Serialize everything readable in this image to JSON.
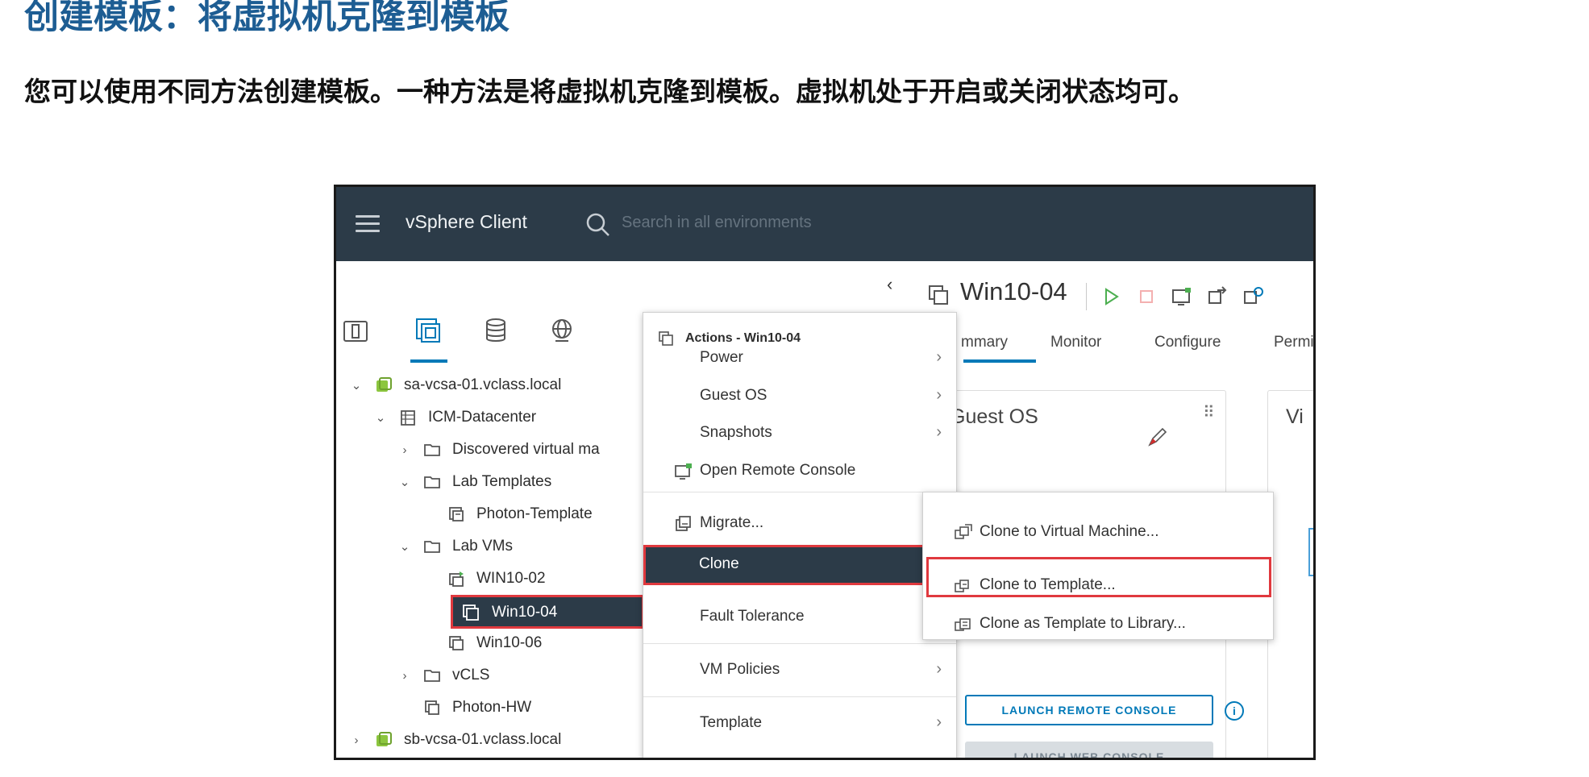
{
  "slide": {
    "title": "创建模板：将虚拟机克隆到模板",
    "text": "您可以使用不同方法创建模板。一种方法是将虚拟机克隆到模板。虚拟机处于开启或关闭状态均可。"
  },
  "header": {
    "app_title": "vSphere Client",
    "search_placeholder": "Search in all environments"
  },
  "inventory_tree": [
    {
      "label": "sa-vcsa-01.vclass.local",
      "caret": "expanded",
      "icon": "vcenter-icon",
      "level": 0
    },
    {
      "label": "ICM-Datacenter",
      "caret": "expanded",
      "icon": "datacenter-icon",
      "level": 1
    },
    {
      "label": "Discovered virtual ma",
      "caret": "collapsed",
      "icon": "folder-icon",
      "level": 2
    },
    {
      "label": "Lab Templates",
      "caret": "expanded",
      "icon": "folder-icon",
      "level": 2
    },
    {
      "label": "Photon-Template",
      "caret": "none",
      "icon": "template-icon",
      "level": 3
    },
    {
      "label": "Lab VMs",
      "caret": "expanded",
      "icon": "folder-icon",
      "level": 2
    },
    {
      "label": "WIN10-02",
      "caret": "none",
      "icon": "vm-on-icon",
      "level": 3
    },
    {
      "label": "Win10-04",
      "caret": "none",
      "icon": "vm-icon",
      "level": 3,
      "selected": true
    },
    {
      "label": "Win10-06",
      "caret": "none",
      "icon": "vm-icon",
      "level": 3
    },
    {
      "label": "vCLS",
      "caret": "collapsed",
      "icon": "folder-icon",
      "level": 2
    },
    {
      "label": "Photon-HW",
      "caret": "none",
      "icon": "vm-icon",
      "level": 2
    },
    {
      "label": "sb-vcsa-01.vclass.local",
      "caret": "collapsed",
      "icon": "vcenter-icon",
      "level": 0
    }
  ],
  "vm_panel": {
    "title": "Win10-04",
    "tabs": [
      "mmary",
      "Monitor",
      "Configure",
      "Permi"
    ],
    "cards": {
      "guest_os_title": "Guest OS",
      "vm_card_title": "Vi"
    },
    "buttons": {
      "launch_remote": "LAUNCH REMOTE CONSOLE",
      "launch_web": "LAUNCH WEB CONSOLE"
    }
  },
  "context_menu": {
    "header": "Actions - Win10-04",
    "items": [
      {
        "label": "Power",
        "submenu": true
      },
      {
        "label": "Guest OS",
        "submenu": true
      },
      {
        "label": "Snapshots",
        "submenu": true
      },
      {
        "label": "Open Remote Console",
        "submenu": false,
        "icon": "remote-console-icon"
      },
      {
        "label": "Migrate...",
        "submenu": false,
        "icon": "migrate-icon"
      },
      {
        "label": "Clone",
        "submenu": true,
        "highlighted": true
      },
      {
        "label": "Fault Tolerance",
        "submenu": true
      },
      {
        "label": "VM Policies",
        "submenu": true
      },
      {
        "label": "Template",
        "submenu": true
      }
    ]
  },
  "clone_submenu": [
    {
      "label": "Clone to Virtual Machine...",
      "icon": "clone-vm-icon"
    },
    {
      "label": "Clone to Template...",
      "icon": "clone-template-icon",
      "highlighted": true
    },
    {
      "label": "Clone as Template to Library...",
      "icon": "clone-library-icon"
    }
  ],
  "colors": {
    "header_bg": "#2c3b48",
    "accent_blue": "#0079b8",
    "highlight_red": "#e0393e",
    "title_blue": "#1d5d93"
  }
}
